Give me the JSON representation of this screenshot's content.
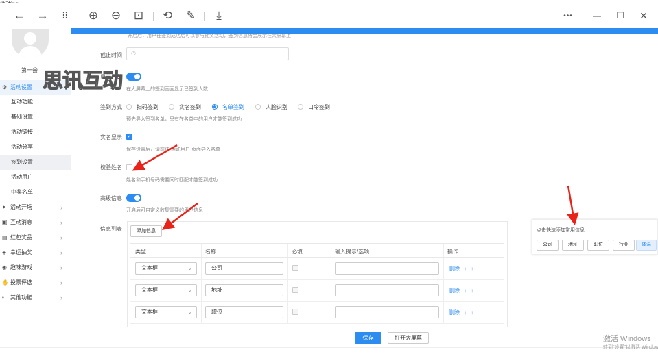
{
  "window": {
    "cut_title": "活动ing",
    "more_icon_label": "•••",
    "minimize_label": "—",
    "maximize_label": "☐",
    "close_label": "✕"
  },
  "toolbar": {
    "icons": [
      "back-icon",
      "forward-icon",
      "grid-icon",
      "zoom-in-icon",
      "zoom-out-icon",
      "fit-page-icon",
      "rotate-icon",
      "edit-icon",
      "download-icon"
    ],
    "glyphs": [
      "←",
      "→",
      "⠿",
      "⊕",
      "⊖",
      "⊡",
      "⟲",
      "✎",
      "⤓"
    ]
  },
  "banner": {
    "cut_text": "开启后，用户在签到成功后可以参与抽奖活动，签到信息将会展示在大屏幕上"
  },
  "sidebar": {
    "user_name": "第一会",
    "watermark": "思讯互动",
    "items": [
      {
        "label": "活动设置",
        "icon": "settings-icon",
        "glyph": "⚙",
        "active": true
      },
      {
        "label": "互动功能"
      },
      {
        "label": "基础设置"
      },
      {
        "label": "活动链接"
      },
      {
        "label": "活动分享"
      },
      {
        "label": "签到设置",
        "selected": true
      },
      {
        "label": "活动用户"
      },
      {
        "label": "中奖名单"
      },
      {
        "label": "活动开场",
        "icon": "send-icon",
        "glyph": "➤",
        "expandable": true
      },
      {
        "label": "互动消息",
        "icon": "message-icon",
        "glyph": "▣",
        "expandable": true
      },
      {
        "label": "红包奖品",
        "icon": "redpacket-icon",
        "glyph": "▤",
        "expandable": true
      },
      {
        "label": "幸运抽奖",
        "icon": "lottery-icon",
        "glyph": "◈",
        "expandable": true
      },
      {
        "label": "趣味游戏",
        "icon": "game-icon",
        "glyph": "◉",
        "expandable": true
      },
      {
        "label": "投票评选",
        "icon": "vote-icon",
        "glyph": "✋",
        "expandable": true
      },
      {
        "label": "其他功能",
        "icon": "more-icon",
        "glyph": "•",
        "expandable": true
      }
    ]
  },
  "form": {
    "deadline": {
      "label": "截止时间",
      "value": "",
      "icon": "clock-icon"
    },
    "show_count": {
      "label": "显示人数",
      "on": true,
      "hint": "在大屏幕上的签到画面显示已签到人数"
    },
    "signin_method": {
      "label": "签到方式",
      "options": [
        "扫码签到",
        "实名签到",
        "名单签到",
        "人脸识别",
        "口令签到"
      ],
      "selected": "名单签到",
      "hint": "预先导入签到名单，只有在名单中的用户才能签到成功"
    },
    "realname_display": {
      "label": "实名显示",
      "checked": true,
      "hint": "保存设置后，请前往 活动用户 页面导入名单"
    },
    "verify_name": {
      "label": "校验姓名",
      "checked": false,
      "hint": "姓名和手机号码需要同时匹配才能签到成功"
    },
    "advanced_info": {
      "label": "高级信息",
      "on": true,
      "hint": "开启后可自定义收集需要的用户信息"
    },
    "info_list": {
      "label": "信息列表",
      "add_button": "添加信息",
      "columns": [
        "类型",
        "名称",
        "必填",
        "输入提示/选项",
        "操作"
      ],
      "rows": [
        {
          "type": "文本框",
          "name": "公司"
        },
        {
          "type": "文本框",
          "name": "地址"
        },
        {
          "type": "文本框",
          "name": "职位"
        }
      ],
      "delete_label": "删除",
      "down_arrow": "↓",
      "up_arrow": "↑",
      "chevron": "⌄"
    }
  },
  "quick_add": {
    "title": "点击快速添加常用信息",
    "buttons": [
      "公司",
      "地址",
      "职位",
      "行业",
      "体温"
    ],
    "highlighted": "体温"
  },
  "footer": {
    "save": "保存",
    "open_screen": "打开大屏幕"
  },
  "windows_activation": {
    "title": "激活 Windows",
    "subtitle": "转到\"设置\"以激活 Windows。"
  }
}
